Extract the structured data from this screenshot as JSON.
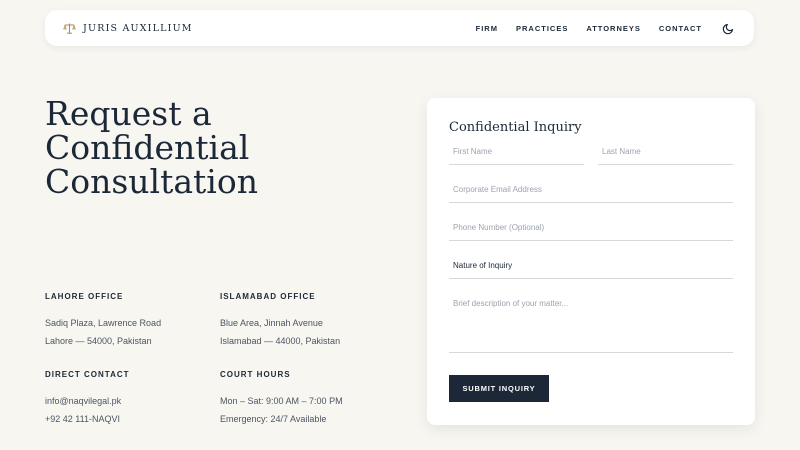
{
  "nav": {
    "brand": "JURIS AUXILLIUM",
    "brand_icon": "scales-icon",
    "links": [
      "FIRM",
      "PRACTICES",
      "ATTORNEYS",
      "CONTACT"
    ],
    "theme_icon": "moon-icon"
  },
  "hero": {
    "title_lines": [
      "Request a",
      "Confidential",
      "Consultation"
    ]
  },
  "offices": {
    "lahore": {
      "heading": "LAHORE OFFICE",
      "line1": "Sadiq Plaza, Lawrence Road",
      "line2": "Lahore — 54000, Pakistan"
    },
    "islamabad": {
      "heading": "ISLAMABAD OFFICE",
      "line1": "Blue Area, Jinnah Avenue",
      "line2": "Islamabad — 44000, Pakistan"
    },
    "contact": {
      "heading": "DIRECT CONTACT",
      "line1": "info@naqvilegal.pk",
      "line2": "+92 42 111-NAQVI"
    },
    "hours": {
      "heading": "COURT HOURS",
      "line1": "Mon – Sat: 9:00 AM – 7:00 PM",
      "line2": "Emergency: 24/7 Available"
    }
  },
  "form": {
    "title": "Confidential Inquiry",
    "first_name": "First Name",
    "last_name": "Last Name",
    "email": "Corporate Email Address",
    "phone": "Phone Number (Optional)",
    "nature": "Nature of Inquiry",
    "description": "Brief description of your matter...",
    "submit": "SUBMIT INQUIRY"
  },
  "colors": {
    "background": "#f8f6f1",
    "primary": "#1c2838",
    "accent": "#b08a4a"
  }
}
